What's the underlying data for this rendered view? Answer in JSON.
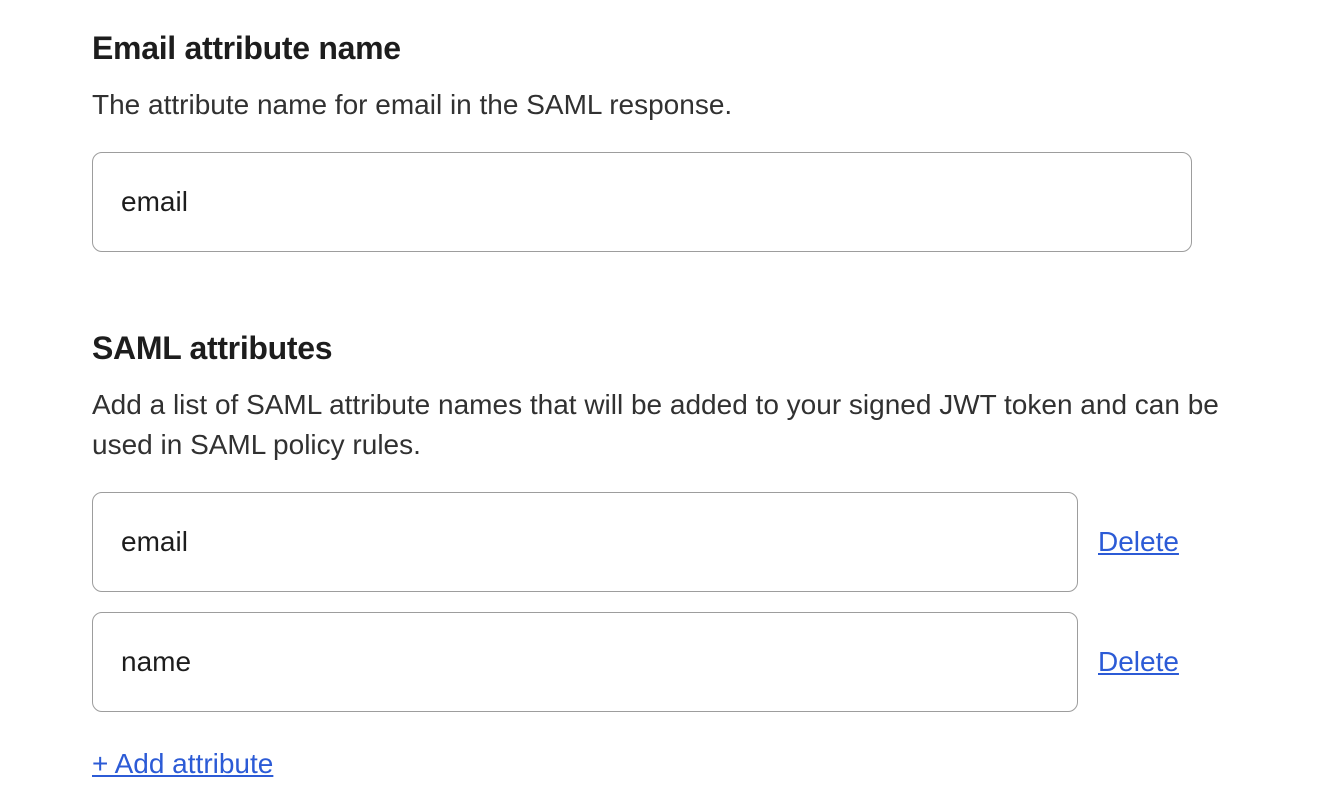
{
  "email_attr": {
    "heading": "Email attribute name",
    "description": "The attribute name for email in the SAML response.",
    "value": "email"
  },
  "saml_attrs": {
    "heading": "SAML attributes",
    "description": "Add a list of SAML attribute names that will be added to your signed JWT token and can be used in SAML policy rules.",
    "items": [
      {
        "value": "email"
      },
      {
        "value": "name"
      }
    ],
    "delete_label": "Delete",
    "add_label": "+ Add attribute"
  }
}
